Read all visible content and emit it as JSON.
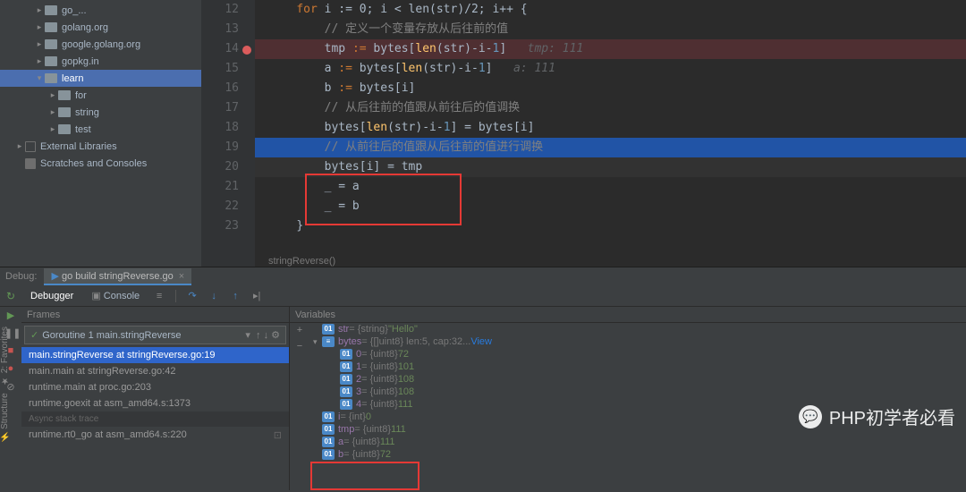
{
  "sidebar": {
    "items": [
      {
        "label": "go_...",
        "indent": "ind-1",
        "arrow": "▸"
      },
      {
        "label": "golang.org",
        "indent": "ind-1",
        "arrow": "▸"
      },
      {
        "label": "google.golang.org",
        "indent": "ind-1",
        "arrow": "▸"
      },
      {
        "label": "gopkg.in",
        "indent": "ind-1",
        "arrow": "▸"
      },
      {
        "label": "learn",
        "indent": "ind-1",
        "arrow": "▾",
        "selected": true
      },
      {
        "label": "for",
        "indent": "ind-2",
        "arrow": "▸"
      },
      {
        "label": "string",
        "indent": "ind-2",
        "arrow": "▸"
      },
      {
        "label": "test",
        "indent": "ind-2",
        "arrow": "▸"
      },
      {
        "label": "External Libraries",
        "indent": "ind-0",
        "arrow": "▸",
        "lib": true
      },
      {
        "label": "Scratches and Consoles",
        "indent": "ind-0",
        "arrow": "",
        "scratch": true
      }
    ]
  },
  "editor": {
    "lines": [
      {
        "num": "12",
        "tokens": {
          "pre": "    ",
          "kw": "for",
          "rest": " i := 0; i < len(str)/2; i++ {"
        },
        "cls": ""
      },
      {
        "num": "13",
        "tokens": {
          "pre": "        ",
          "cmt": "// 定义一个变量存放从后往前的值"
        },
        "cls": ""
      },
      {
        "num": "14",
        "tokens": {
          "pre": "        ",
          "lhs": "tmp ",
          "op": ":=",
          "rest": " bytes[",
          "fn": "len",
          "after": "(str)-i-",
          "n": "1",
          "close": "]",
          "hint": "   tmp: 111"
        },
        "cls": "hl-red",
        "bp": true
      },
      {
        "num": "15",
        "tokens": {
          "pre": "        ",
          "lhs": "a ",
          "op": ":=",
          "rest": " bytes[",
          "fn": "len",
          "after": "(str)-i-",
          "n": "1",
          "close": "]",
          "hint": "   a: 111"
        },
        "cls": ""
      },
      {
        "num": "16",
        "tokens": {
          "pre": "        ",
          "lhs": "b ",
          "op": ":=",
          "rest": " bytes[i]"
        },
        "cls": ""
      },
      {
        "num": "17",
        "tokens": {
          "pre": "        ",
          "cmt": "// 从后往前的值跟从前往后的值调换"
        },
        "cls": ""
      },
      {
        "num": "18",
        "tokens": {
          "pre": "        ",
          "lhs": "bytes[",
          "fn": "len",
          "after": "(str)-i-",
          "n": "1",
          "close": "] = bytes[i]"
        },
        "cls": ""
      },
      {
        "num": "19",
        "tokens": {
          "pre": "        ",
          "cmt": "// 从前往后的值跟从后往前的值进行调换"
        },
        "cls": "hl-blue"
      },
      {
        "num": "20",
        "tokens": {
          "pre": "        ",
          "lhs": "bytes[i] = tmp"
        },
        "cls": "hl-dark"
      },
      {
        "num": "21",
        "tokens": {
          "pre": "        ",
          "lhs": "_ = a"
        },
        "cls": ""
      },
      {
        "num": "22",
        "tokens": {
          "pre": "        ",
          "lhs": "_ = b"
        },
        "cls": ""
      },
      {
        "num": "23",
        "tokens": {
          "pre": "    ",
          "lhs": "}"
        },
        "cls": ""
      }
    ],
    "breadcrumb": "stringReverse()"
  },
  "debug": {
    "label": "Debug:",
    "tab": "go build stringReverse.go",
    "tabs": {
      "debugger": "Debugger",
      "console": "Console"
    },
    "frames": {
      "header": "Frames",
      "dropdown": "Goroutine 1 main.stringReverse",
      "items": [
        {
          "label": "main.stringReverse at stringReverse.go:19",
          "sel": true
        },
        {
          "label": "main.main at stringReverse.go:42"
        },
        {
          "label": "runtime.main at proc.go:203"
        },
        {
          "label": "runtime.goexit at asm_amd64.s:1373"
        }
      ],
      "async": "Async stack trace",
      "async_item": "runtime.rt0_go at asm_amd64.s:220"
    },
    "vars": {
      "header": "Variables",
      "items": [
        {
          "ind": 0,
          "arrow": "",
          "ico": "01",
          "name": "str",
          "type": " = {string}",
          "val": " \"Hello\""
        },
        {
          "ind": 0,
          "arrow": "▾",
          "ico": "≡",
          "name": "bytes",
          "type": " = {[]uint8} len:5, cap:32",
          "link": " ... View"
        },
        {
          "ind": 1,
          "arrow": "",
          "ico": "01",
          "name": "0",
          "type": " = {uint8}",
          "val": " 72"
        },
        {
          "ind": 1,
          "arrow": "",
          "ico": "01",
          "name": "1",
          "type": " = {uint8}",
          "val": " 101"
        },
        {
          "ind": 1,
          "arrow": "",
          "ico": "01",
          "name": "2",
          "type": " = {uint8}",
          "val": " 108"
        },
        {
          "ind": 1,
          "arrow": "",
          "ico": "01",
          "name": "3",
          "type": " = {uint8}",
          "val": " 108"
        },
        {
          "ind": 1,
          "arrow": "",
          "ico": "01",
          "name": "4",
          "type": " = {uint8}",
          "val": " 111"
        },
        {
          "ind": 0,
          "arrow": "",
          "ico": "01",
          "name": "i",
          "type": " = {int}",
          "val": " 0"
        },
        {
          "ind": 0,
          "arrow": "",
          "ico": "01",
          "name": "tmp",
          "type": " = {uint8}",
          "val": " 111"
        },
        {
          "ind": 0,
          "arrow": "",
          "ico": "01",
          "name": "a",
          "type": " = {uint8}",
          "val": " 111"
        },
        {
          "ind": 0,
          "arrow": "",
          "ico": "01",
          "name": "b",
          "type": " = {uint8}",
          "val": " 72"
        }
      ]
    }
  },
  "watermark": "PHP初学者必看"
}
